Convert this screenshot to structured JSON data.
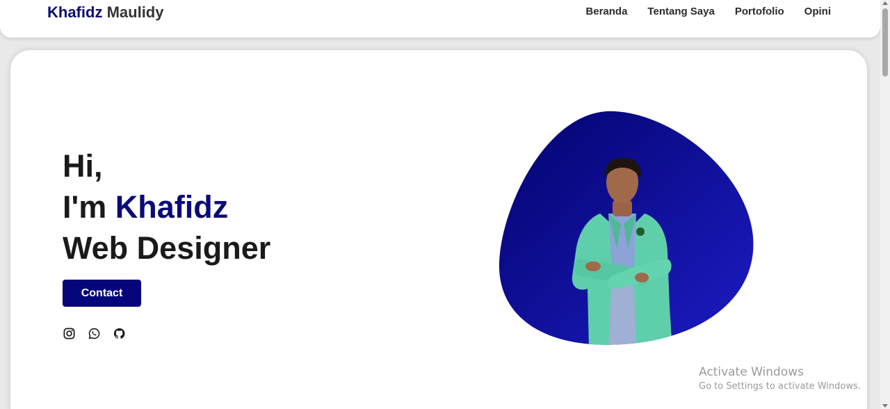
{
  "brand": {
    "first": "Khafidz",
    "last": "Maulidy"
  },
  "nav": {
    "items": [
      {
        "label": "Beranda"
      },
      {
        "label": "Tentang Saya"
      },
      {
        "label": "Portofolio"
      },
      {
        "label": "Opini"
      }
    ]
  },
  "hero": {
    "greeting": "Hi,",
    "intro_prefix": "I'm ",
    "name": "Khafidz",
    "role": "Web Designer",
    "contact_label": "Contact"
  },
  "socials": [
    {
      "icon": "instagram-icon"
    },
    {
      "icon": "whatsapp-icon"
    },
    {
      "icon": "github-icon"
    }
  ],
  "windows_watermark": {
    "title": "Activate Windows",
    "subtitle": "Go to Settings to activate Windows."
  },
  "colors": {
    "brand_accent": "#0a0a78",
    "button": "#06067a",
    "blob_dark": "#03036e",
    "blob_light": "#1c1cc4",
    "coat": "#5fcfab"
  }
}
